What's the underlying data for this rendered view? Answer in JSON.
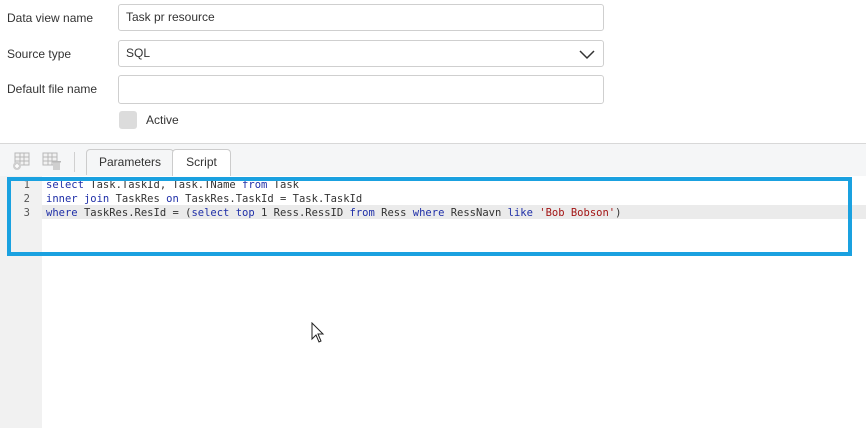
{
  "form": {
    "data_view_name_label": "Data view name",
    "data_view_name_value": "Task pr resource",
    "source_type_label": "Source type",
    "source_type_value": "SQL",
    "default_file_name_label": "Default file name",
    "default_file_name_value": "",
    "active_label": "Active",
    "active_checked": false
  },
  "toolbar": {
    "icons": [
      "add-table-icon",
      "delete-table-icon"
    ],
    "tabs": [
      {
        "label": "Parameters",
        "active": false
      },
      {
        "label": "Script",
        "active": true
      }
    ]
  },
  "editor": {
    "line_numbers": [
      "1",
      "2",
      "3"
    ],
    "lines": [
      "select Task.TaskId, Task.TName from Task",
      "inner join TaskRes on TaskRes.TaskId = Task.TaskId",
      "where TaskRes.ResId = (select top 1 Ress.RessID from Ress where RessNavn like 'Bob Bobson')"
    ]
  },
  "colors": {
    "highlight_border": "#1aa1e0",
    "keyword": "#1f2fa8",
    "string": "#a31515"
  }
}
